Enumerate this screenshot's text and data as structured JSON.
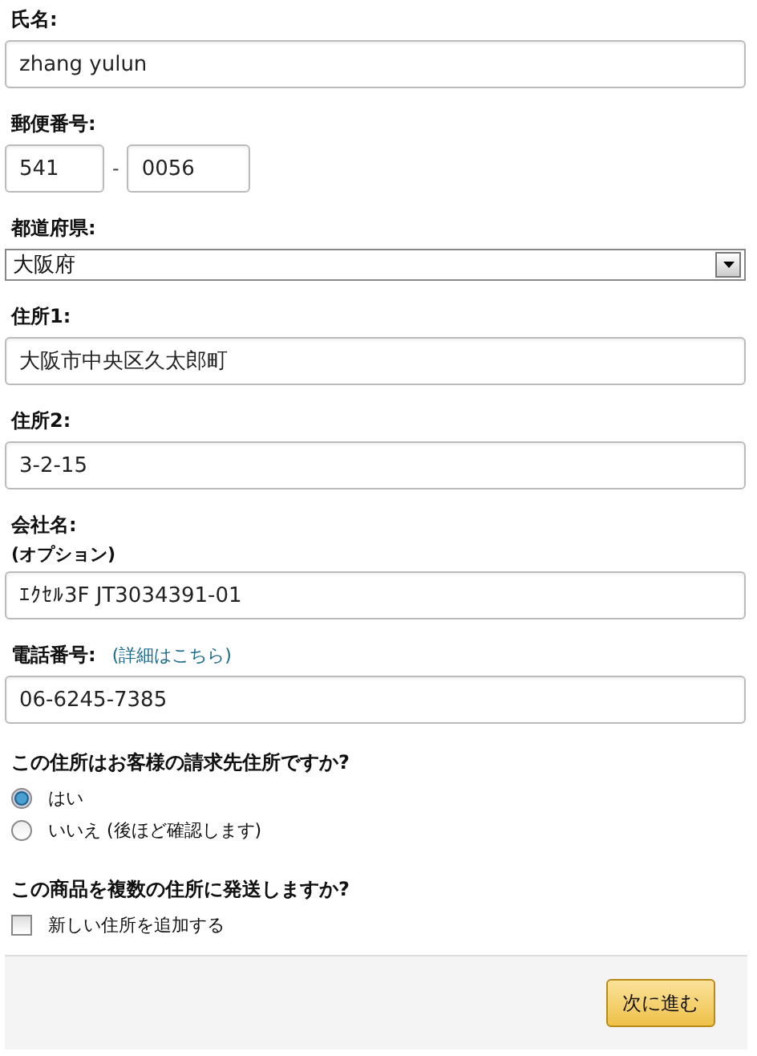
{
  "fields": [
    {
      "kind": "text",
      "label": "氏名:",
      "value": "zhang yulun"
    },
    {
      "kind": "postal",
      "label": "郵便番号:",
      "values": [
        "541",
        "0056"
      ],
      "separator": "-"
    },
    {
      "kind": "select",
      "label": "都道府県:",
      "value": "大阪府"
    },
    {
      "kind": "text",
      "label": "住所1:",
      "value": "大阪市中央区久太郎町"
    },
    {
      "kind": "text",
      "label": "住所2:",
      "value": "3-2-15"
    },
    {
      "kind": "text",
      "label": "会社名:",
      "sublabel": "(オプション)",
      "value": "ｴｸｾﾙ3F JT3034391-01"
    },
    {
      "kind": "text",
      "label": "電話番号:",
      "link": "(詳細はこちら)",
      "value": "06-6245-7385"
    }
  ],
  "billing_question": {
    "label": "この住所はお客様の請求先住所ですか?",
    "options": [
      {
        "label": "はい",
        "selected": true
      },
      {
        "label": "いいえ (後ほど確認します)",
        "selected": false
      }
    ]
  },
  "multi_question": {
    "label": "この商品を複数の住所に発送しますか?",
    "checkbox": {
      "label": "新しい住所を追加する",
      "checked": false
    }
  },
  "footer": {
    "button": "次に進む"
  }
}
